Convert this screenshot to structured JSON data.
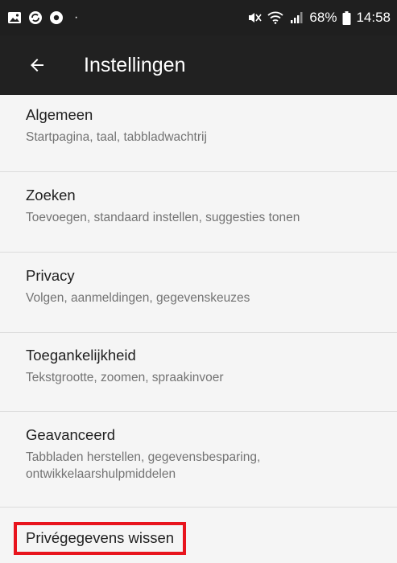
{
  "status_bar": {
    "battery_percent": "68%",
    "time": "14:58",
    "left_icons": [
      "gallery-icon",
      "sync-icon",
      "record-icon"
    ],
    "right_icons": [
      "mute-icon",
      "wifi-icon",
      "signal-icon",
      "battery-icon"
    ]
  },
  "app_bar": {
    "back_icon": "arrow-left-icon",
    "title": "Instellingen"
  },
  "settings": {
    "items": [
      {
        "title": "Algemeen",
        "summary": "Startpagina, taal, tabbladwachtrij"
      },
      {
        "title": "Zoeken",
        "summary": "Toevoegen, standaard instellen, suggesties tonen"
      },
      {
        "title": "Privacy",
        "summary": "Volgen, aanmeldingen, gegevenskeuzes"
      },
      {
        "title": "Toegankelijkheid",
        "summary": "Tekstgrootte, zoomen, spraakinvoer"
      },
      {
        "title": "Geavanceerd",
        "summary_line1": "Tabbladen herstellen, gegevensbesparing,",
        "summary_line2": "ontwikkelaarshulpmiddelen"
      },
      {
        "title": "Privégegevens wissen",
        "highlighted": true
      }
    ]
  },
  "colors": {
    "status_bar_bg": "#1f1f1f",
    "app_bar_bg": "#212121",
    "list_bg": "#f5f5f5",
    "highlight": "#e8141d"
  }
}
